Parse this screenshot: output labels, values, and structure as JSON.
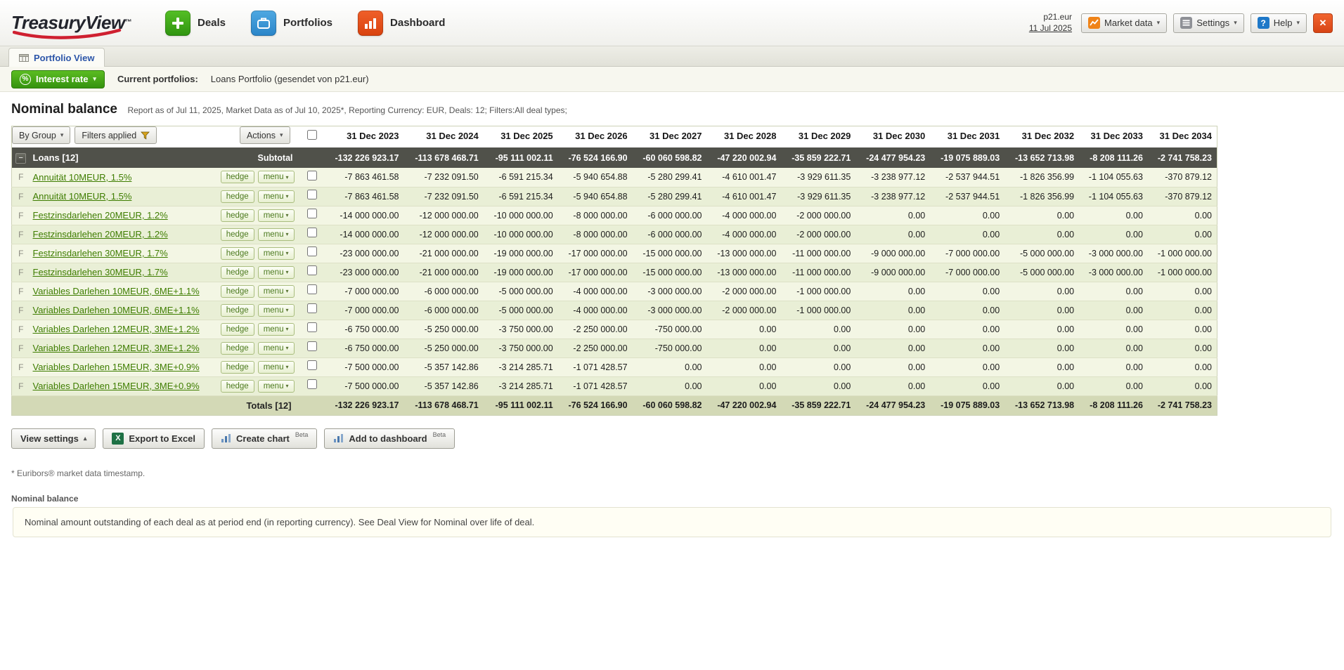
{
  "header": {
    "logo": {
      "part1": "Treasury",
      "part2": "View",
      "tm": "™"
    },
    "nav": [
      {
        "label": "Deals"
      },
      {
        "label": "Portfolios"
      },
      {
        "label": "Dashboard"
      }
    ],
    "user": "p21.eur",
    "date": "11 Jul 2025",
    "market_data": "Market data",
    "settings": "Settings",
    "help": "Help"
  },
  "tabs": [
    {
      "label": "Portfolio View"
    }
  ],
  "portfolio_bar": {
    "interest_rate": "Interest rate",
    "label": "Current portfolios:",
    "value": "Loans Portfolio (gesendet von p21.eur)"
  },
  "report": {
    "title": "Nominal balance",
    "subtitle": "Report as of Jul 11, 2025, Market Data as of Jul 10, 2025*, Reporting Currency: EUR, Deals: 12; Filters:All deal types;"
  },
  "toolbar": {
    "by_group": "By Group",
    "filters_applied": "Filters applied",
    "actions": "Actions"
  },
  "table": {
    "deal_type_badge": "F",
    "group_label": "Loans [12]",
    "subtotal_label": "Subtotal",
    "totals_label": "Totals [12]",
    "hedge_label": "hedge",
    "menu_label": "menu",
    "columns": [
      "31 Dec 2023",
      "31 Dec 2024",
      "31 Dec 2025",
      "31 Dec 2026",
      "31 Dec 2027",
      "31 Dec 2028",
      "31 Dec 2029",
      "31 Dec 2030",
      "31 Dec 2031",
      "31 Dec 2032",
      "31 Dec 2033",
      "31 Dec 2034"
    ],
    "subtotal": [
      "-132 226 923.17",
      "-113 678 468.71",
      "-95 111 002.11",
      "-76 524 166.90",
      "-60 060 598.82",
      "-47 220 002.94",
      "-35 859 222.71",
      "-24 477 954.23",
      "-19 075 889.03",
      "-13 652 713.98",
      "-8 208 111.26",
      "-2 741 758.23"
    ],
    "totals": [
      "-132 226 923.17",
      "-113 678 468.71",
      "-95 111 002.11",
      "-76 524 166.90",
      "-60 060 598.82",
      "-47 220 002.94",
      "-35 859 222.71",
      "-24 477 954.23",
      "-19 075 889.03",
      "-13 652 713.98",
      "-8 208 111.26",
      "-2 741 758.23"
    ],
    "rows": [
      {
        "name": "Annuität 10MEUR, 1.5%",
        "values": [
          "-7 863 461.58",
          "-7 232 091.50",
          "-6 591 215.34",
          "-5 940 654.88",
          "-5 280 299.41",
          "-4 610 001.47",
          "-3 929 611.35",
          "-3 238 977.12",
          "-2 537 944.51",
          "-1 826 356.99",
          "-1 104 055.63",
          "-370 879.12"
        ]
      },
      {
        "name": "Annuität 10MEUR, 1.5%",
        "values": [
          "-7 863 461.58",
          "-7 232 091.50",
          "-6 591 215.34",
          "-5 940 654.88",
          "-5 280 299.41",
          "-4 610 001.47",
          "-3 929 611.35",
          "-3 238 977.12",
          "-2 537 944.51",
          "-1 826 356.99",
          "-1 104 055.63",
          "-370 879.12"
        ]
      },
      {
        "name": "Festzinsdarlehen 20MEUR, 1.2%",
        "values": [
          "-14 000 000.00",
          "-12 000 000.00",
          "-10 000 000.00",
          "-8 000 000.00",
          "-6 000 000.00",
          "-4 000 000.00",
          "-2 000 000.00",
          "0.00",
          "0.00",
          "0.00",
          "0.00",
          "0.00"
        ]
      },
      {
        "name": "Festzinsdarlehen 20MEUR, 1.2%",
        "values": [
          "-14 000 000.00",
          "-12 000 000.00",
          "-10 000 000.00",
          "-8 000 000.00",
          "-6 000 000.00",
          "-4 000 000.00",
          "-2 000 000.00",
          "0.00",
          "0.00",
          "0.00",
          "0.00",
          "0.00"
        ]
      },
      {
        "name": "Festzinsdarlehen 30MEUR, 1.7%",
        "values": [
          "-23 000 000.00",
          "-21 000 000.00",
          "-19 000 000.00",
          "-17 000 000.00",
          "-15 000 000.00",
          "-13 000 000.00",
          "-11 000 000.00",
          "-9 000 000.00",
          "-7 000 000.00",
          "-5 000 000.00",
          "-3 000 000.00",
          "-1 000 000.00"
        ]
      },
      {
        "name": "Festzinsdarlehen 30MEUR, 1.7%",
        "values": [
          "-23 000 000.00",
          "-21 000 000.00",
          "-19 000 000.00",
          "-17 000 000.00",
          "-15 000 000.00",
          "-13 000 000.00",
          "-11 000 000.00",
          "-9 000 000.00",
          "-7 000 000.00",
          "-5 000 000.00",
          "-3 000 000.00",
          "-1 000 000.00"
        ]
      },
      {
        "name": "Variables Darlehen 10MEUR, 6ME+1.1%",
        "values": [
          "-7 000 000.00",
          "-6 000 000.00",
          "-5 000 000.00",
          "-4 000 000.00",
          "-3 000 000.00",
          "-2 000 000.00",
          "-1 000 000.00",
          "0.00",
          "0.00",
          "0.00",
          "0.00",
          "0.00"
        ]
      },
      {
        "name": "Variables Darlehen 10MEUR, 6ME+1.1%",
        "values": [
          "-7 000 000.00",
          "-6 000 000.00",
          "-5 000 000.00",
          "-4 000 000.00",
          "-3 000 000.00",
          "-2 000 000.00",
          "-1 000 000.00",
          "0.00",
          "0.00",
          "0.00",
          "0.00",
          "0.00"
        ]
      },
      {
        "name": "Variables Darlehen 12MEUR, 3ME+1.2%",
        "values": [
          "-6 750 000.00",
          "-5 250 000.00",
          "-3 750 000.00",
          "-2 250 000.00",
          "-750 000.00",
          "0.00",
          "0.00",
          "0.00",
          "0.00",
          "0.00",
          "0.00",
          "0.00"
        ]
      },
      {
        "name": "Variables Darlehen 12MEUR, 3ME+1.2%",
        "values": [
          "-6 750 000.00",
          "-5 250 000.00",
          "-3 750 000.00",
          "-2 250 000.00",
          "-750 000.00",
          "0.00",
          "0.00",
          "0.00",
          "0.00",
          "0.00",
          "0.00",
          "0.00"
        ]
      },
      {
        "name": "Variables Darlehen 15MEUR, 3ME+0.9%",
        "values": [
          "-7 500 000.00",
          "-5 357 142.86",
          "-3 214 285.71",
          "-1 071 428.57",
          "0.00",
          "0.00",
          "0.00",
          "0.00",
          "0.00",
          "0.00",
          "0.00",
          "0.00"
        ]
      },
      {
        "name": "Variables Darlehen 15MEUR, 3ME+0.9%",
        "values": [
          "-7 500 000.00",
          "-5 357 142.86",
          "-3 214 285.71",
          "-1 071 428.57",
          "0.00",
          "0.00",
          "0.00",
          "0.00",
          "0.00",
          "0.00",
          "0.00",
          "0.00"
        ]
      }
    ]
  },
  "footer": {
    "view_settings": "View settings",
    "export_excel": "Export to Excel",
    "create_chart": "Create chart",
    "add_to_dashboard": "Add to dashboard",
    "beta": "Beta",
    "footnote": "* Euribors® market data timestamp.",
    "info_title": "Nominal balance",
    "info_text": "Nominal amount outstanding of each deal as at period end (in reporting currency). See Deal View for Nominal over life of deal."
  },
  "icons": {
    "chevron_down": "▾",
    "chevron_up": "▴",
    "close": "✕",
    "collapse": "−",
    "percent": "%",
    "question": "?",
    "excel": "X"
  },
  "colors": {
    "brand_red": "#cf2030",
    "nav_green": "#3aa716",
    "nav_blue": "#3399d6",
    "nav_orange": "#e04a12",
    "interest_green": "#43a216",
    "link_green": "#3e7d00",
    "group_header_bg": "#50514a",
    "row_bg_odd": "#f3f6e4",
    "row_bg_even": "#e9efd6",
    "totals_bg": "#d3d9b6",
    "info_box_bg": "#fffef4"
  }
}
